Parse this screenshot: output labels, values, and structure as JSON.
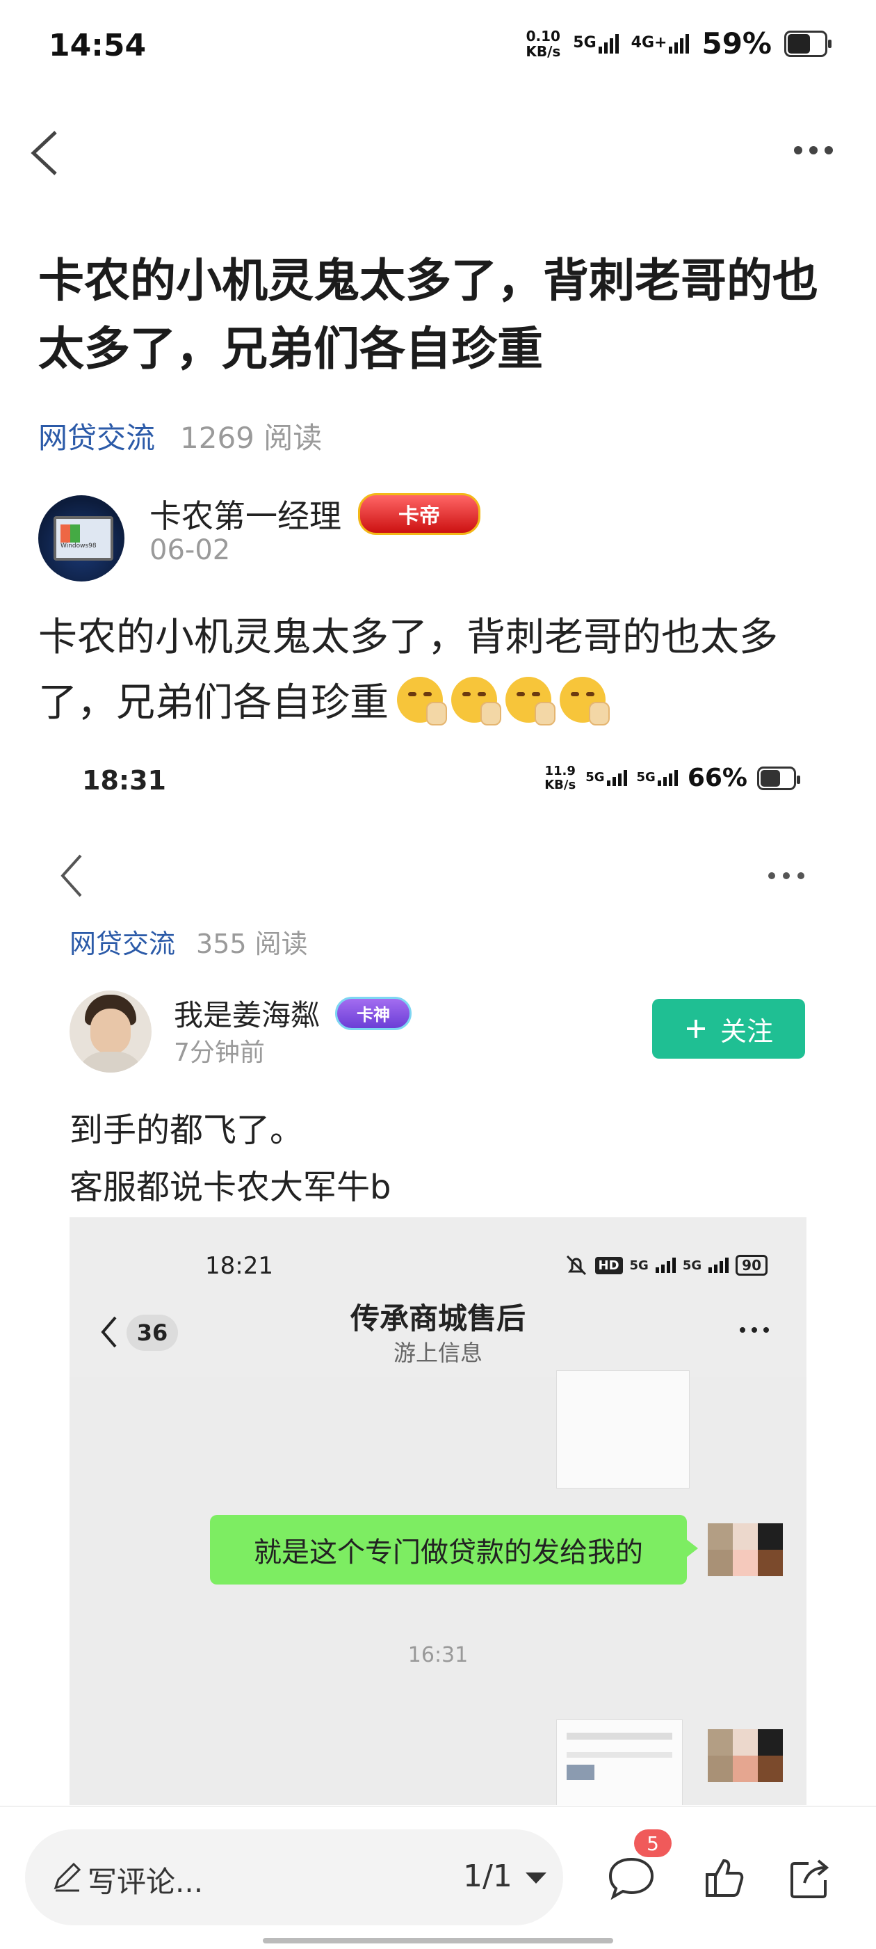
{
  "status_bar": {
    "time": "14:54",
    "speed": "0.10",
    "speed_unit": "KB/s",
    "net1": "5G",
    "net2": "4G+",
    "battery": "59%",
    "battery_level": 0.59
  },
  "nav": {
    "back_icon": "back-chevron-icon",
    "more_icon": "more-dots-icon"
  },
  "post": {
    "title": "卡农的小机灵鬼太多了，背刺老哥的也太多了，兄弟们各自珍重",
    "category": "网贷交流",
    "reads": "1269 阅读",
    "author": {
      "name": "卡农第一经理",
      "badge": "卡帝",
      "date": "06-02"
    },
    "content": "卡农的小机灵鬼太多了，背刺老哥的也太多了，兄弟们各自珍重",
    "emoji_count": 4
  },
  "embedded": {
    "status": {
      "time": "18:31",
      "speed": "11.9",
      "speed_unit": "KB/s",
      "net1": "5G",
      "net2": "5G",
      "battery": "66%",
      "battery_level": 0.66
    },
    "category": "网贷交流",
    "reads": "355 阅读",
    "author": {
      "name": "我是姜海粼",
      "badge": "卡神",
      "time": "7分钟前"
    },
    "follow_label": "关注",
    "follow_icon": "plus-icon",
    "content_line1": "到手的都飞了。",
    "content_line2": "客服都说卡农大军牛b",
    "chat": {
      "time": "18:21",
      "unread": "36",
      "title": "传承商城售后",
      "subtitle": "游上信息",
      "battery": "90",
      "hd": "HD",
      "message": "就是这个专门做贷款的发给我的",
      "timestamp": "16:31"
    }
  },
  "bottom": {
    "comment_placeholder": "写评论...",
    "pager": "1/1",
    "comment_badge": "5"
  }
}
